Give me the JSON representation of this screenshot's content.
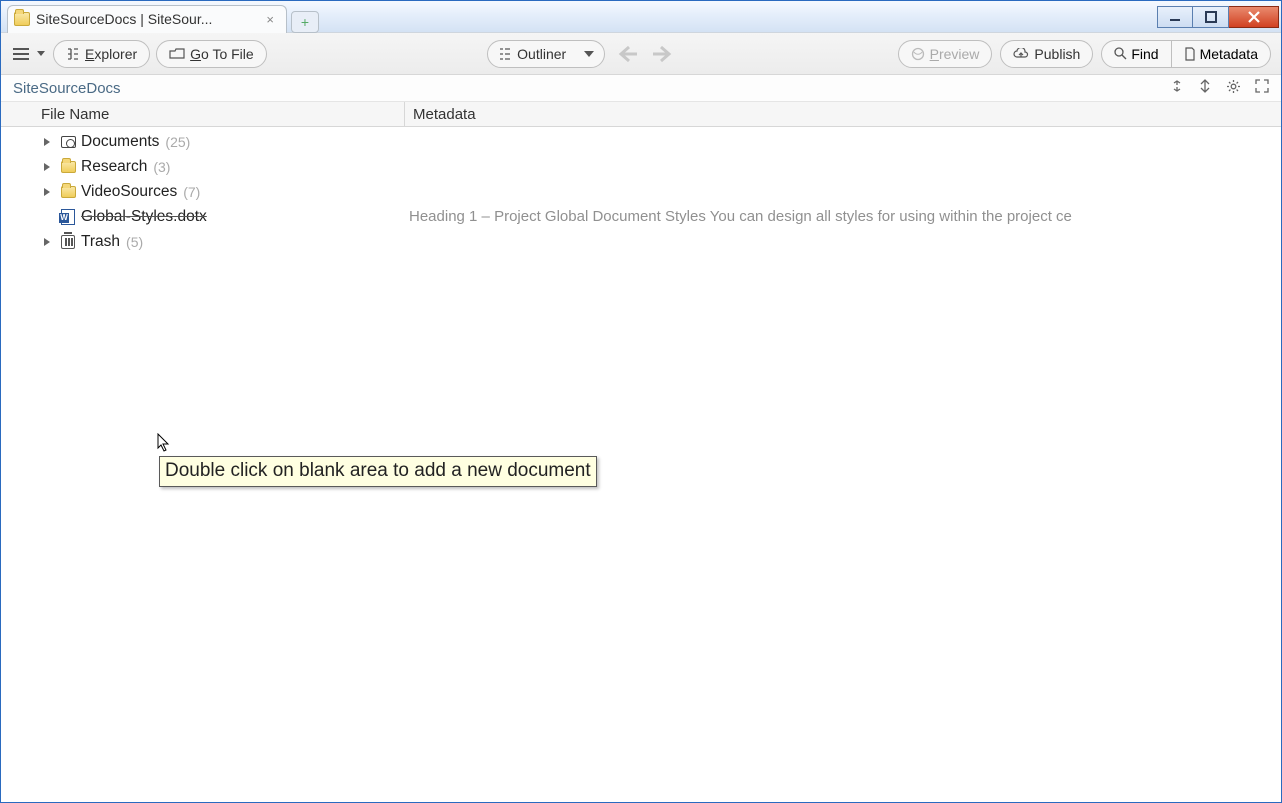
{
  "window": {
    "tab_title": "SiteSourceDocs | SiteSour..."
  },
  "toolbar": {
    "explorer": "Explorer",
    "explorer_key": "E",
    "gotofile": "Go To File",
    "gotofile_key": "G",
    "outliner": "Outliner",
    "preview": "Preview",
    "preview_key": "P",
    "publish": "Publish",
    "find": "Find",
    "find_key": "F",
    "metadata": "Metadata",
    "metadata_key": "M"
  },
  "breadcrumb": "SiteSourceDocs",
  "columns": {
    "filename": "File Name",
    "metadata": "Metadata"
  },
  "tree": [
    {
      "icon": "camera",
      "label": "Documents",
      "count": "(25)",
      "expandable": true
    },
    {
      "icon": "folder",
      "label": "Research",
      "count": "(3)",
      "expandable": true
    },
    {
      "icon": "folder",
      "label": "VideoSources",
      "count": "(7)",
      "expandable": true
    },
    {
      "icon": "word",
      "label": "Global-Styles.dotx",
      "strike": true,
      "expandable": false,
      "metadata": "Heading 1 – Project Global Document Styles You can design all styles for using within the project ce"
    },
    {
      "icon": "trash",
      "label": "Trash",
      "count": "(5)",
      "expandable": true
    }
  ],
  "tooltip": "Double click on blank area to add a new document"
}
